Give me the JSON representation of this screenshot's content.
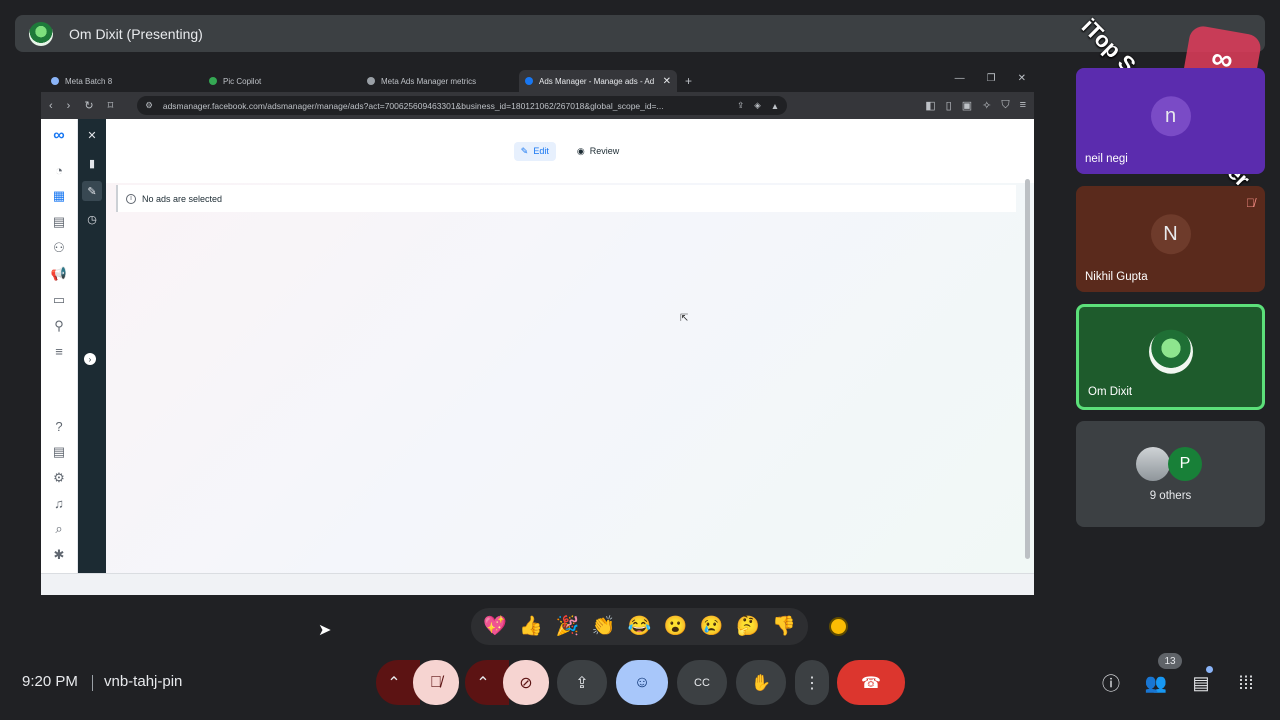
{
  "presenter": {
    "name": "Om Dixit (Presenting)"
  },
  "watermark": {
    "text": "iTop Screen Recorder"
  },
  "browser": {
    "tabs": [
      {
        "label": "Meta Batch 8",
        "icon_color": "#8ab4f8"
      },
      {
        "label": "Pic Copilot",
        "icon_color": "#34a853"
      },
      {
        "label": "Meta Ads Manager metrics",
        "icon_color": "#9aa0a6"
      },
      {
        "label": "Ads Manager - Manage ads - Ad",
        "icon_color": "#1877f2"
      }
    ],
    "url": "adsmanager.facebook.com/adsmanager/manage/ads?act=700625609463301&business_id=180121062/267018&global_scope_id=..."
  },
  "ads_manager": {
    "edit_label": "Edit",
    "review_label": "Review",
    "notice": "No ads are selected"
  },
  "participants": {
    "p1": {
      "name": "neil negi",
      "initial": "n"
    },
    "p2": {
      "name": "Nikhil Gupta",
      "initial": "N",
      "muted": true
    },
    "p3": {
      "name": "Om Dixit"
    },
    "others": {
      "label": "9 others",
      "initial": "P"
    }
  },
  "reactions": [
    "💖",
    "👍",
    "🎉",
    "👏",
    "😂",
    "😮",
    "😢",
    "🤔",
    "👎"
  ],
  "meeting": {
    "time": "9:20 PM",
    "code": "vnb-tahj-pin",
    "people_count": "13"
  },
  "colors": {
    "end_call": "#dc362e",
    "active_speaker": "#5ce07a",
    "emoji_active": "#a8c7fa"
  }
}
